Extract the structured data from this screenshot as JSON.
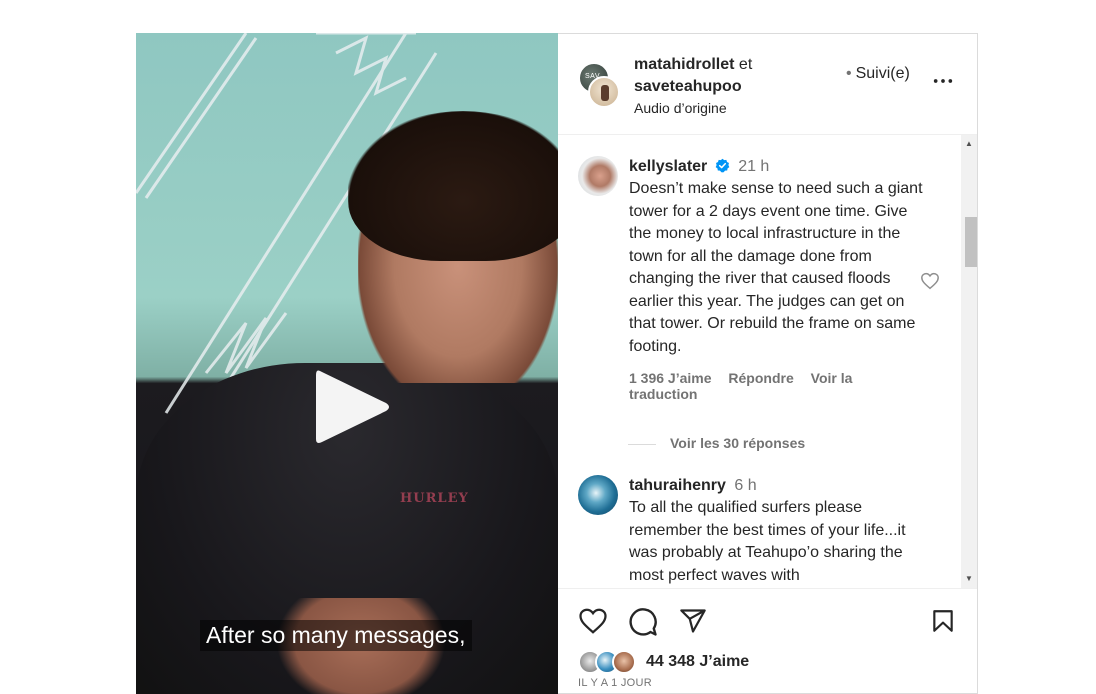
{
  "video": {
    "caption": "After so many messages,",
    "shirt_brand": "HURLEY"
  },
  "header": {
    "user1": "matahidrollet",
    "conjunction": "et",
    "user2": "saveteahupoo",
    "audio": "Audio d’origine",
    "follow_label": "Suivi(e)",
    "follow_dot": "•"
  },
  "comments": [
    {
      "username": "kellyslater",
      "verified": true,
      "time": "21 h",
      "text": "Doesn’t make sense to need such a giant tower for a 2 days event one time. Give the money to local infrastructure in the town for all the damage done from changing the river that caused floods earlier this year. The judges can get on that tower. Or rebuild the frame on same footing.",
      "likes": "1 396 J’aime",
      "reply_label": "Répondre",
      "translate_label": "Voir la traduction",
      "replies_label": "Voir les 30 réponses"
    },
    {
      "username": "tahuraihenry",
      "time": "6 h",
      "text": "To all the qualified surfers please remember the best times of your life...it was probably at Teahupo’o sharing the most perfect waves with"
    }
  ],
  "footer": {
    "likes": "44 348 J’aime",
    "when": "IL Y A 1 JOUR"
  },
  "icons": {
    "like": "heart-icon",
    "comment": "comment-icon",
    "share": "share-icon",
    "save": "bookmark-icon",
    "more": "more-icon",
    "verified": "verified-badge-icon",
    "play": "play-icon"
  },
  "colors": {
    "verified": "#0095f6",
    "muted_text": "#737373",
    "primary_text": "#262626"
  }
}
